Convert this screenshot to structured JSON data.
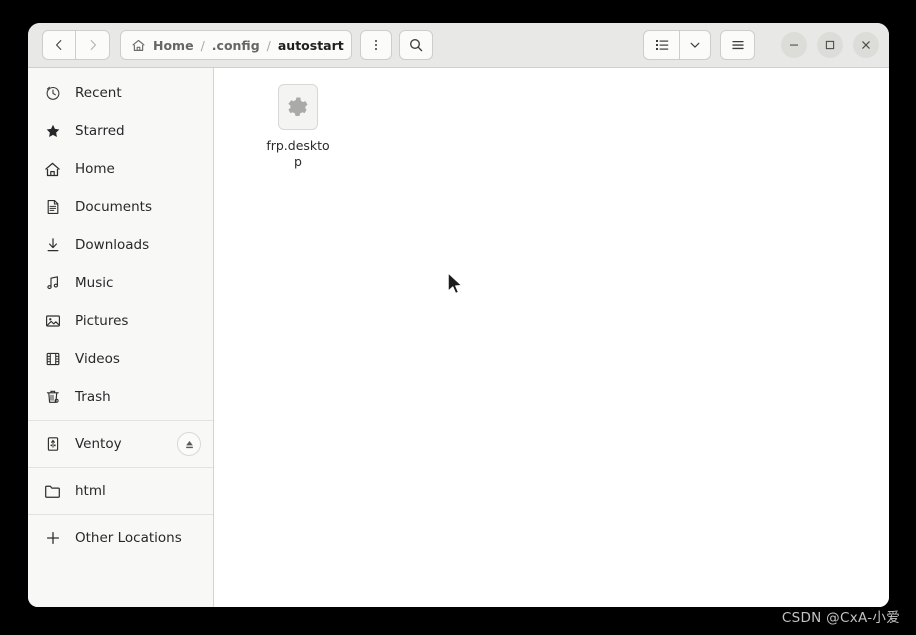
{
  "window": {
    "controls": {
      "minimize_label": "Minimize",
      "maximize_label": "Maximize",
      "close_label": "Close"
    }
  },
  "headerbar": {
    "back_label": "Back",
    "forward_label": "Forward",
    "kebab_label": "Path options",
    "search_label": "Search",
    "view_list_label": "List view",
    "view_dropdown_label": "View options",
    "menu_label": "Main menu",
    "pathbar": {
      "separator": "/",
      "crumbs": [
        {
          "label": "Home",
          "current": false
        },
        {
          "label": ".config",
          "current": false
        },
        {
          "label": "autostart",
          "current": true
        }
      ]
    }
  },
  "sidebar": {
    "items": [
      {
        "label": "Recent",
        "icon": "clock-icon",
        "type": "place"
      },
      {
        "label": "Starred",
        "icon": "star-icon",
        "type": "place"
      },
      {
        "label": "Home",
        "icon": "home-icon",
        "type": "place"
      },
      {
        "label": "Documents",
        "icon": "document-icon",
        "type": "place"
      },
      {
        "label": "Downloads",
        "icon": "download-icon",
        "type": "place"
      },
      {
        "label": "Music",
        "icon": "music-icon",
        "type": "place"
      },
      {
        "label": "Pictures",
        "icon": "picture-icon",
        "type": "place"
      },
      {
        "label": "Videos",
        "icon": "video-icon",
        "type": "place"
      },
      {
        "label": "Trash",
        "icon": "trash-icon",
        "type": "place"
      },
      {
        "label": "Ventoy",
        "icon": "usb-drive-icon",
        "type": "drive",
        "eject": true
      },
      {
        "label": "html",
        "icon": "folder-icon",
        "type": "bookmark"
      },
      {
        "label": "Other Locations",
        "icon": "plus-icon",
        "type": "action"
      }
    ],
    "eject_label": "Eject"
  },
  "content": {
    "files": [
      {
        "name": "frp.desktop",
        "icon": "gear-icon"
      }
    ]
  },
  "watermark": {
    "text": "CSDN @CxA-小爱"
  },
  "colors": {
    "headerbar_bg": "#e8e8e6",
    "sidebar_bg": "#f8f8f7",
    "content_bg": "#ffffff",
    "border": "#d3d3cf",
    "text": "#28282a",
    "text_dim": "#666663"
  }
}
